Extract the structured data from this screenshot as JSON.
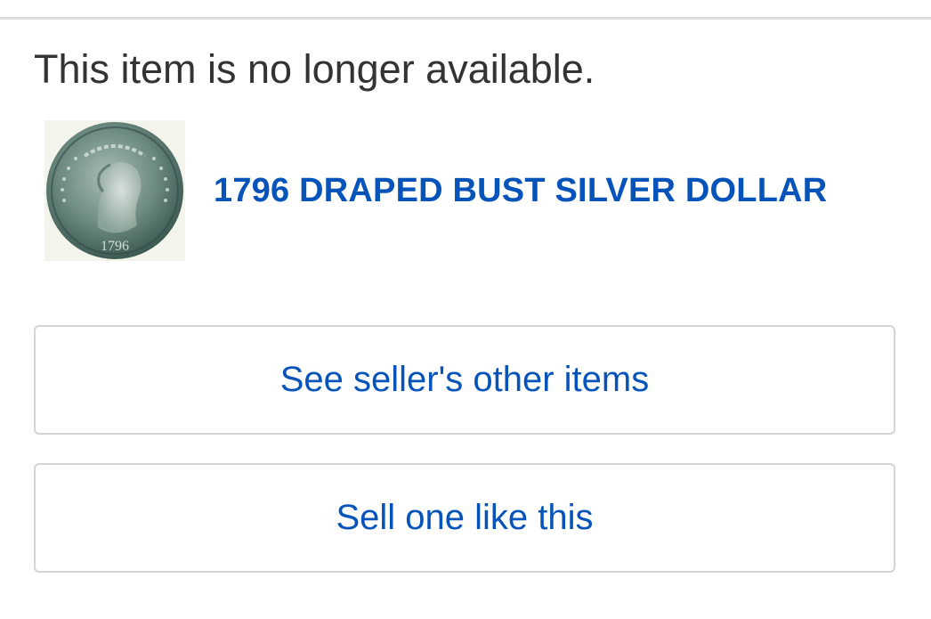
{
  "message": "This item is no longer available.",
  "item": {
    "title": "1796 DRAPED BUST SILVER DOLLAR",
    "thumbnail_icon": "coin-image",
    "link_color": "#0654ba"
  },
  "actions": {
    "see_other_items": "See seller's other items",
    "sell_one_like_this": "Sell one like this"
  }
}
